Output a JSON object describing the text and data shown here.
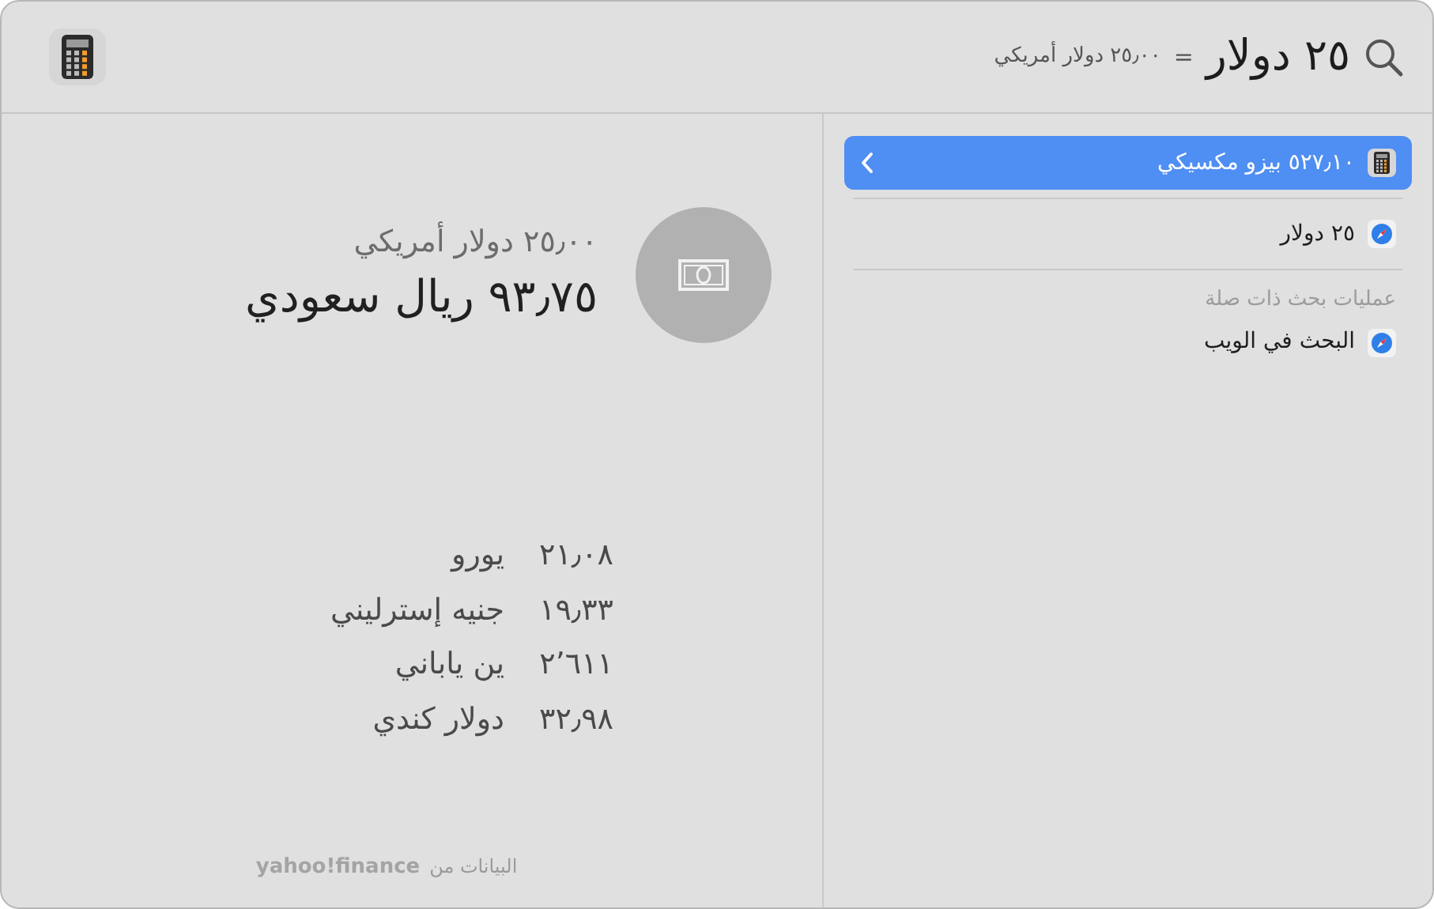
{
  "search": {
    "query": "٢٥ دولار",
    "equals": "=",
    "conversion": "٢٥٫٠٠ دولار أمريكي"
  },
  "results": [
    {
      "kind": "calculator",
      "label": "٥٢٧٫١٠ بيزو مكسيكي",
      "selected": true
    },
    {
      "kind": "web",
      "label": "٢٥ دولار",
      "selected": false
    },
    {
      "kind": "heading",
      "label": "عمليات بحث ذات صلة"
    },
    {
      "kind": "web",
      "label": "البحث في الويب",
      "selected": false
    }
  ],
  "detail": {
    "from": "٢٥٫٠٠ دولار أمريكي",
    "to": "٩٣٫٧٥ ريال سعودي",
    "rates": [
      {
        "value": "٢١٫٠٨",
        "currency": "يورو"
      },
      {
        "value": "١٩٫٣٣",
        "currency": "جنيه إسترليني"
      },
      {
        "value": "٢٬٦١١",
        "currency": "ين ياباني"
      },
      {
        "value": "٣٢٫٩٨",
        "currency": "دولار كندي"
      }
    ],
    "source": {
      "label": "البيانات من",
      "provider": "yahoo!finance"
    }
  }
}
